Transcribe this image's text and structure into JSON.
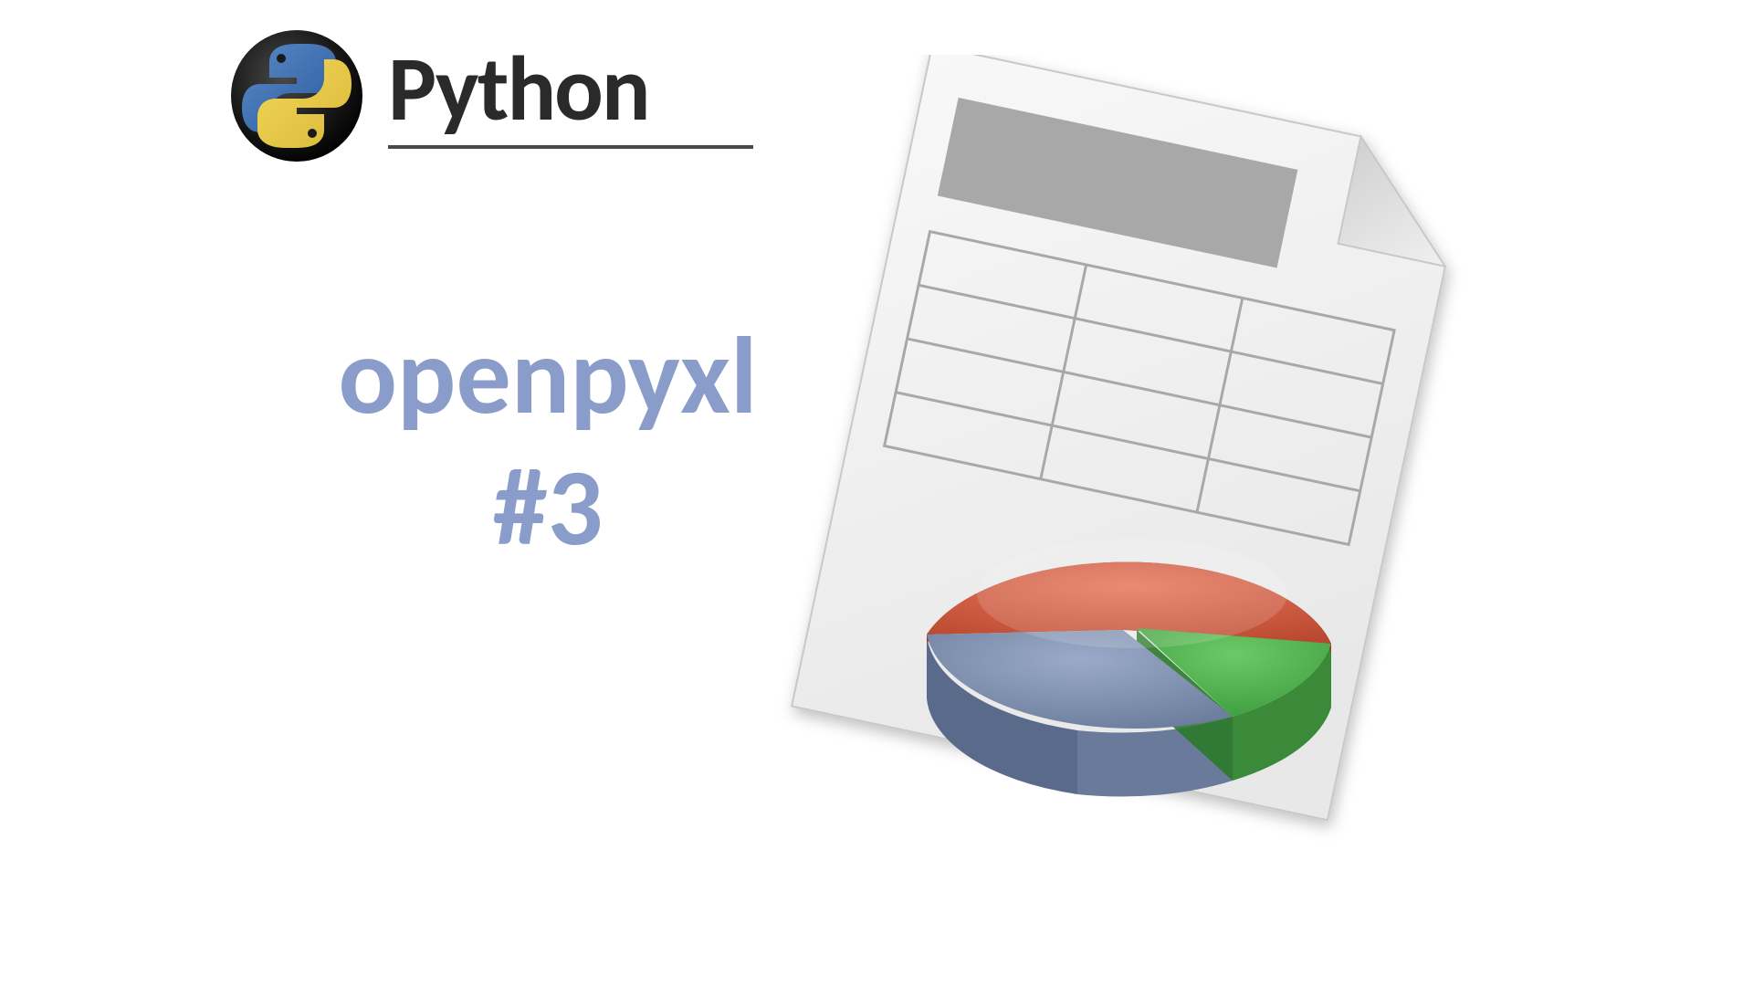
{
  "header": {
    "logo_text": "Python"
  },
  "main": {
    "title_line1": "openpyxl",
    "title_line2": "#3"
  },
  "colors": {
    "title_color": "#8a9cc9",
    "pie_red": "#c94a2f",
    "pie_green": "#4caf50",
    "pie_blue": "#7a8db5"
  }
}
